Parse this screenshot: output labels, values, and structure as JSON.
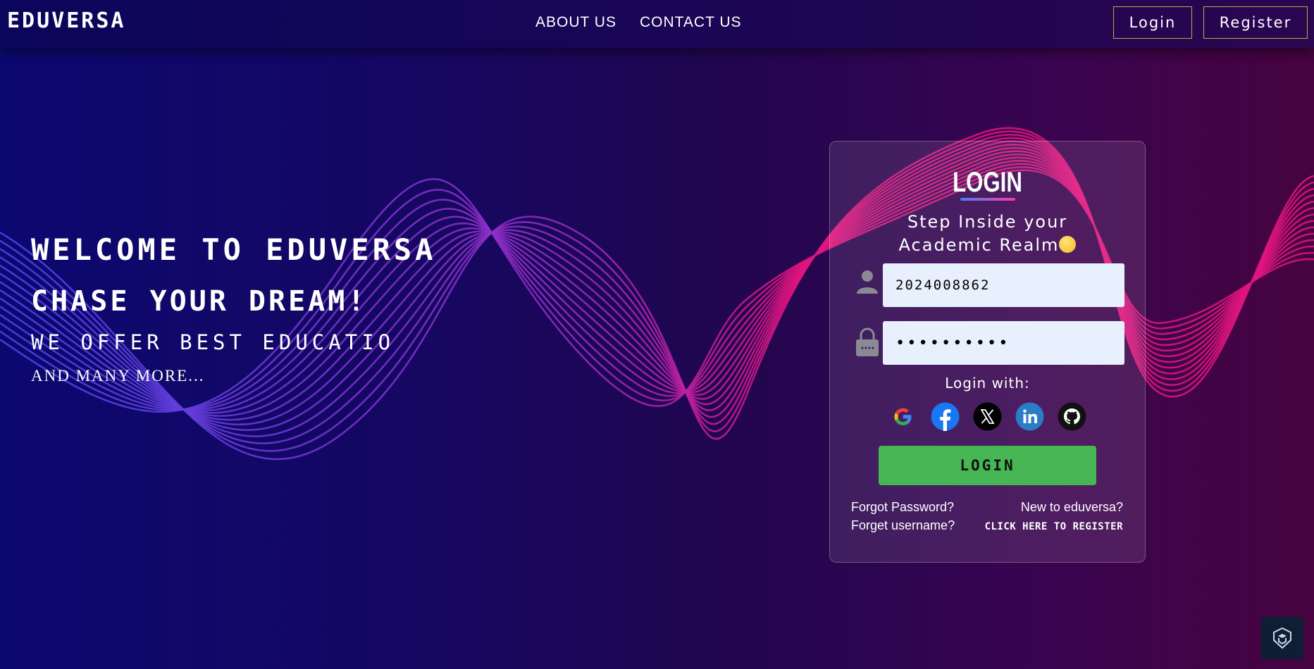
{
  "header": {
    "logo": "EDUVERSA",
    "nav": [
      "ABOUT US",
      "CONTACT US"
    ],
    "login_label": "Login",
    "register_label": "Register"
  },
  "hero": {
    "line1": "WELCOME TO EDUVERSA",
    "line2": "CHASE YOUR DREAM!",
    "line3": "WE OFFER BEST EDUCATIO",
    "line4": "AND MANY MORE..."
  },
  "login_card": {
    "title": "LOGIN",
    "subtitle_line1": "Step Inside your",
    "subtitle_line2": "Academic Realm",
    "username_value": "2024008862",
    "password_value": "••••••••••",
    "login_with": "Login with:",
    "social_icons": [
      "google-icon",
      "facebook-icon",
      "x-icon",
      "linkedin-icon",
      "github-icon"
    ],
    "submit_label": "LOGIN",
    "forgot_password": "Forgot Password?",
    "forgot_username": "Forget username?",
    "new_to": "New to eduversa?",
    "register_link": "CLICK HERE TO REGISTER"
  },
  "colors": {
    "accent_button": "#46b655",
    "header_border": "#c9a540",
    "wave_blue": "#4b45e8",
    "wave_pink": "#e0147e"
  }
}
